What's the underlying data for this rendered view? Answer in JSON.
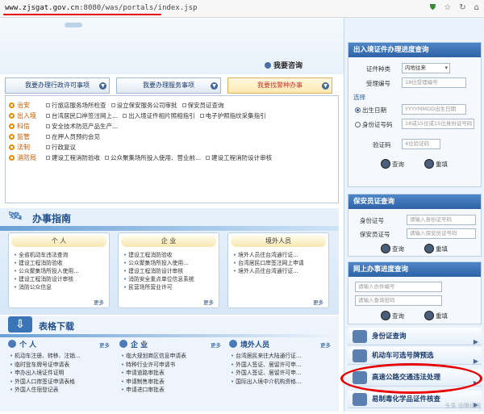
{
  "browser": {
    "url_domain": "www.zjsgat.gov.cn",
    "url_rest": ":8080/was/portals/index.jsp"
  },
  "header": {
    "consult_label": "我要咨询"
  },
  "tabs": [
    {
      "label": "我要办理行政许可事项"
    },
    {
      "label": "我要办理服务事项"
    },
    {
      "label": "我要找警种办事"
    }
  ],
  "services": [
    {
      "category": "治安",
      "items": [
        "行旅店服务场所检查",
        "设立保安服务公司审批",
        "保安员证查询"
      ]
    },
    {
      "category": "出入境",
      "items": [
        "台湾居民口岸签注网上...",
        "出入境证件相片照相指引",
        "电子护照指纹采集指引"
      ]
    },
    {
      "category": "科信",
      "items": [
        "安全技术防范产品生产..."
      ]
    },
    {
      "category": "监管",
      "items": [
        "在押人员预约会见"
      ]
    },
    {
      "category": "法制",
      "items": [
        "行政复议"
      ]
    },
    {
      "category": "消防局",
      "items": [
        "建设工程消防验收",
        "公众聚集场所投入使用、营业前...",
        "建设工程消防设计审核"
      ]
    }
  ],
  "guide": {
    "title": "办事指南",
    "more": "更多",
    "boxes": [
      {
        "header": "个 人",
        "items": [
          "全省机动车违法查询",
          "建设工程消防验收",
          "公众聚集场所投入使用...",
          "建设工程消防设计审核",
          "消防公众信息"
        ]
      },
      {
        "header": "企 业",
        "items": [
          "建设工程消防验收",
          "公众聚集场所投入使用...",
          "建设工程消防设计审核",
          "消防安全重点单位信息系统",
          "民营场所营业许可"
        ]
      },
      {
        "header": "境外人员",
        "items": [
          "境外人员往台湾通行证...",
          "台湾居民口岸签注网上申请",
          "境外人员往台湾通行证..."
        ]
      }
    ]
  },
  "forms": {
    "title": "表格下载",
    "more": "更多",
    "cols": [
      {
        "header": "个 人",
        "items": [
          "机动车注册、转移、注销...",
          "临时登车牌号证申请表",
          "申办出入境证件证明",
          "外国人口岸签证申请表格",
          "外国人住宿登记表"
        ]
      },
      {
        "header": "企 业",
        "items": [
          "临大规划商区信息申请表",
          "特种行业许可申请书",
          "申请道路审批表",
          "申请制售审批表",
          "申请进口审批表"
        ]
      },
      {
        "header": "境外人员",
        "items": [
          "台湾居民来往大陆通行证...",
          "外国人签证、居留许可申...",
          "外国人签证、居留许可申...",
          "国际出入境中介机构资格..."
        ]
      }
    ]
  },
  "right": {
    "section1": {
      "title": "出入境证件办理进度查询",
      "type_label": "证件种类",
      "type_value": "内地往来",
      "accept_label": "受理编号",
      "accept_placeholder": "18位受理编号",
      "choose_label": "选择",
      "birth_label": "出生日期",
      "birth_placeholder": "YYYYMMDD出生日期",
      "id_label": "身份证号码",
      "id_placeholder": "18或15位或15位身份证号码",
      "code_label": "验证码",
      "code_placeholder": "4位验证码",
      "query": "查询",
      "reset": "重填"
    },
    "section2": {
      "title": "保安员证查询",
      "id_label": "身份证号",
      "id_placeholder": "请输入身份证号码",
      "cert_label": "保安员证号",
      "cert_placeholder": "请输入保安员证号码",
      "query": "查询",
      "reset": "重填"
    },
    "section3": {
      "title": "网上办事进度查询",
      "p1": "请输入办件编号",
      "p2": "请输入查询密码",
      "query": "查询",
      "reset": "重填"
    },
    "links": [
      "身份证查询",
      "机动车可选号牌预选",
      "高速公路交通违法处理",
      "易制毒化学品证件核查"
    ]
  },
  "watermark": "头条 @腾讯网"
}
